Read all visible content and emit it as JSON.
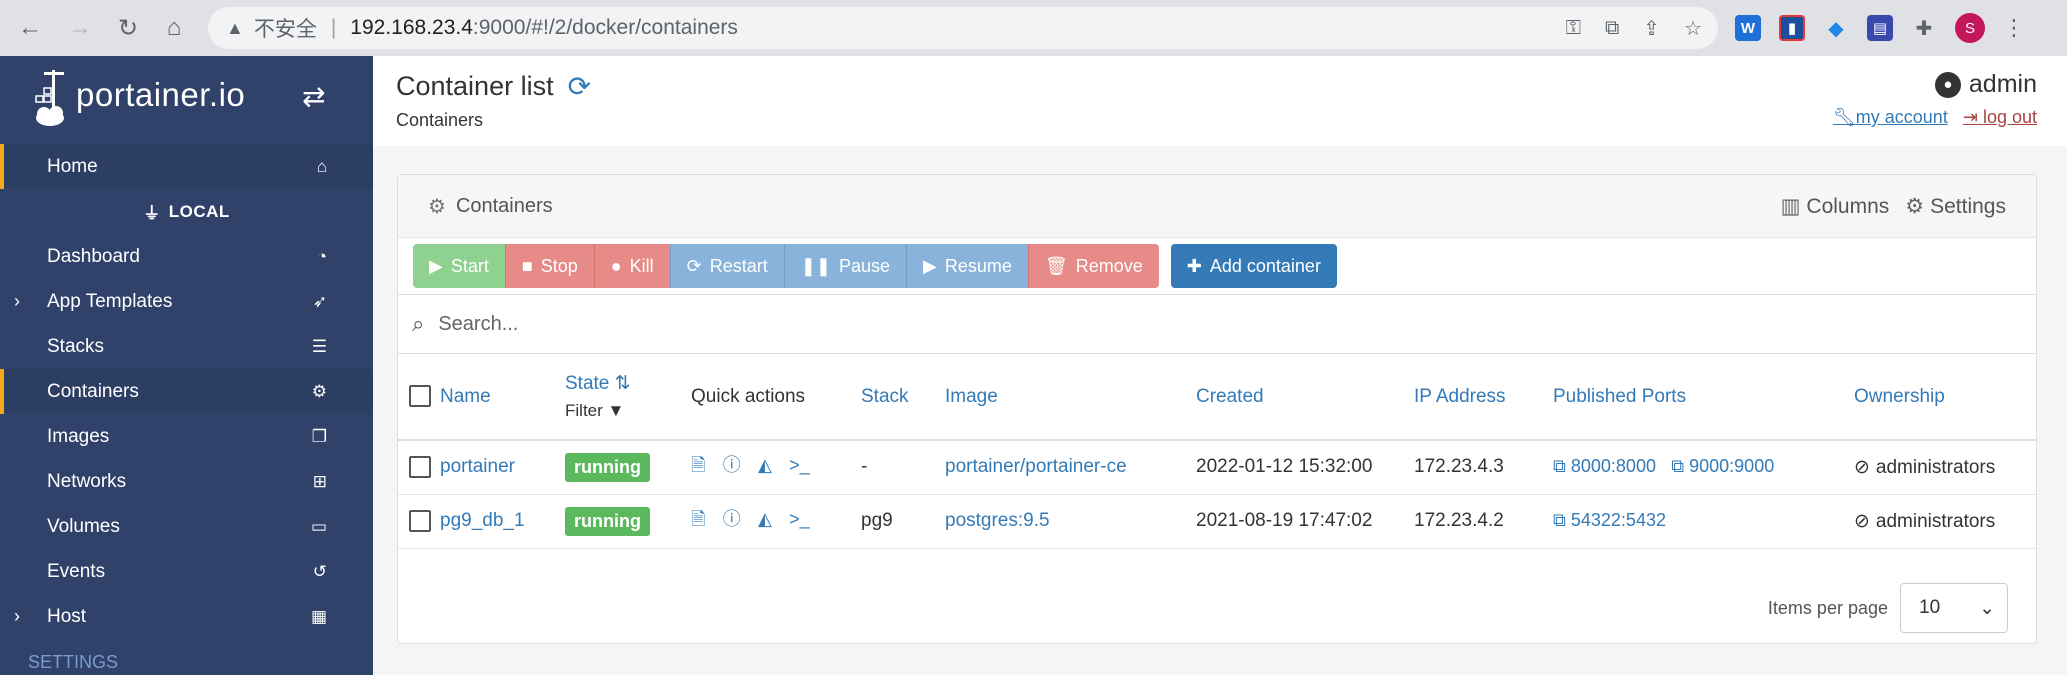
{
  "browser": {
    "back": "←",
    "forward": "→",
    "reload": "↻",
    "home": "⌂",
    "warning_icon": "▲",
    "insecure_label": "不安全",
    "separator": "|",
    "url_host": "192.168.23.4",
    "url_path": ":9000/#!/2/docker/containers",
    "profile_initial": "S"
  },
  "sidebar": {
    "logo_text": "portainer.io",
    "switch_icon": "⇄",
    "home_label": "Home",
    "endpoint_label": "LOCAL",
    "items": [
      {
        "label": "Dashboard",
        "icon": "dashboard-icon",
        "glyph": "◔",
        "chevron": ""
      },
      {
        "label": "App Templates",
        "icon": "rocket-icon",
        "glyph": "➶",
        "chevron": "›"
      },
      {
        "label": "Stacks",
        "icon": "list-icon",
        "glyph": "☰",
        "chevron": ""
      },
      {
        "label": "Containers",
        "icon": "cubes-icon",
        "glyph": "⚙",
        "chevron": ""
      },
      {
        "label": "Images",
        "icon": "clone-icon",
        "glyph": "❐",
        "chevron": ""
      },
      {
        "label": "Networks",
        "icon": "sitemap-icon",
        "glyph": "⊞",
        "chevron": ""
      },
      {
        "label": "Volumes",
        "icon": "hdd-icon",
        "glyph": "▭",
        "chevron": ""
      },
      {
        "label": "Events",
        "icon": "history-icon",
        "glyph": "↺",
        "chevron": ""
      },
      {
        "label": "Host",
        "icon": "th-icon",
        "glyph": "▦",
        "chevron": "›"
      }
    ],
    "settings_label": "SETTINGS"
  },
  "header": {
    "title": "Container list",
    "breadcrumb": "Containers",
    "username": "admin",
    "my_account": "my account",
    "log_out": "log out"
  },
  "widget": {
    "title": "Containers",
    "columns_label": "Columns",
    "settings_label": "Settings"
  },
  "toolbar": {
    "start": "Start",
    "stop": "Stop",
    "kill": "Kill",
    "restart": "Restart",
    "pause": "Pause",
    "resume": "Resume",
    "remove": "Remove",
    "add_container": "Add container"
  },
  "search": {
    "placeholder": "Search..."
  },
  "table": {
    "headers": {
      "name": "Name",
      "state": "State",
      "state_filter": "Filter",
      "quick_actions": "Quick actions",
      "stack": "Stack",
      "image": "Image",
      "created": "Created",
      "ip_address": "IP Address",
      "published_ports": "Published Ports",
      "ownership": "Ownership"
    },
    "rows": [
      {
        "name": "portainer",
        "state": "running",
        "stack": "-",
        "image": "portainer/portainer-ce",
        "created": "2022-01-12 15:32:00",
        "ip": "172.23.4.3",
        "ports": [
          "8000:8000",
          "9000:9000"
        ],
        "ownership": "administrators"
      },
      {
        "name": "pg9_db_1",
        "state": "running",
        "stack": "pg9",
        "image": "postgres:9.5",
        "created": "2021-08-19 17:47:02",
        "ip": "172.23.4.2",
        "ports": [
          "54322:5432"
        ],
        "ownership": "administrators"
      }
    ]
  },
  "pagination": {
    "items_per_page_label": "Items per page",
    "items_per_page_value": "10"
  },
  "colors": {
    "sidebar_bg": "#30426a",
    "accent": "#337ab7",
    "running": "#5cb85c",
    "active_marker": "#f6a71b"
  }
}
